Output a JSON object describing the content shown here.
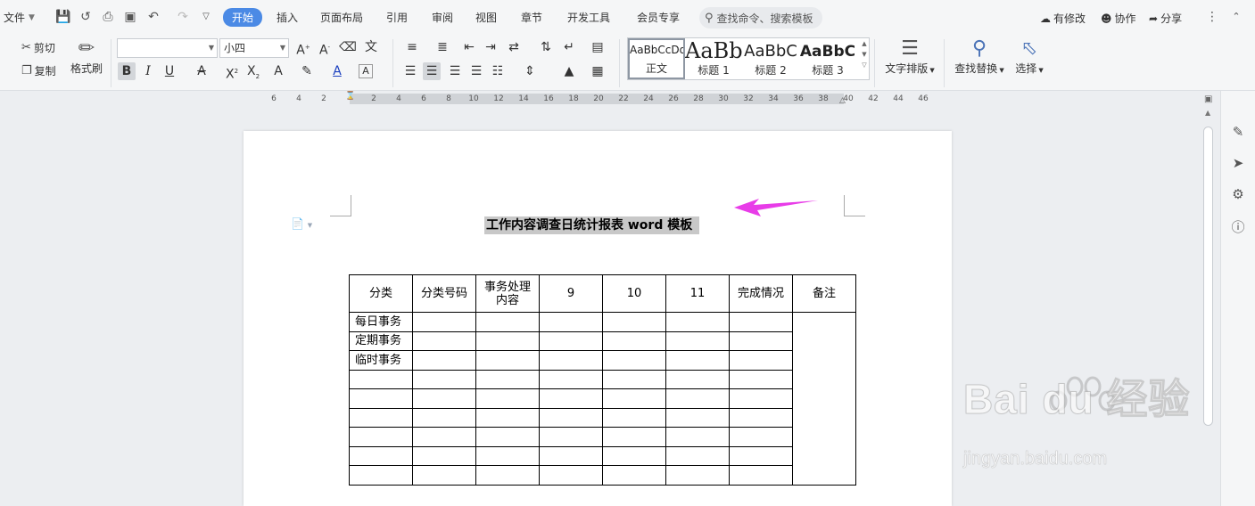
{
  "menubar": {
    "file_label": "文件",
    "tabs": [
      "开始",
      "插入",
      "页面布局",
      "引用",
      "审阅",
      "视图",
      "章节",
      "开发工具",
      "会员专享"
    ],
    "active_tab": "开始",
    "search_placeholder": "查找命令、搜索模板",
    "right_actions": [
      "有修改",
      "协作",
      "分享"
    ]
  },
  "ribbon": {
    "cut_label": "剪切",
    "copy_label": "复制",
    "format_painter_label": "格式刷",
    "font_name_value": "",
    "font_size_value": "小四",
    "styles": [
      {
        "sample": "AaBbCcDd",
        "label": "正文"
      },
      {
        "sample": "AaBb",
        "label": "标题 1"
      },
      {
        "sample": "AaBbC",
        "label": "标题 2"
      },
      {
        "sample": "AaBbC",
        "label": "标题 3"
      }
    ],
    "text_layout_label": "文字排版",
    "find_replace_label": "查找替换",
    "select_label": "选择"
  },
  "ruler": {
    "ticks": [
      "6",
      "4",
      "2",
      "2",
      "4",
      "6",
      "8",
      "10",
      "12",
      "14",
      "16",
      "18",
      "20",
      "22",
      "24",
      "26",
      "28",
      "30",
      "32",
      "34",
      "36",
      "38",
      "40",
      "42",
      "44",
      "46"
    ]
  },
  "document": {
    "title": "工作内容调查日统计报表 word 模板",
    "table": {
      "header": [
        "分类",
        "分类号码",
        "事务处理内容",
        "9",
        "10",
        "11",
        "完成情况",
        "备注"
      ],
      "row_labels": [
        "每日事务",
        "定期事务",
        "临时事务",
        "",
        "",
        "",
        "",
        "",
        ""
      ]
    }
  },
  "watermark": {
    "brand": "Bai du 经验",
    "domain": "jingyan.baidu.com"
  },
  "colors": {
    "accent": "#4b8ae5",
    "arrow": "#e83ce8",
    "selection": "#c8c8c8"
  }
}
